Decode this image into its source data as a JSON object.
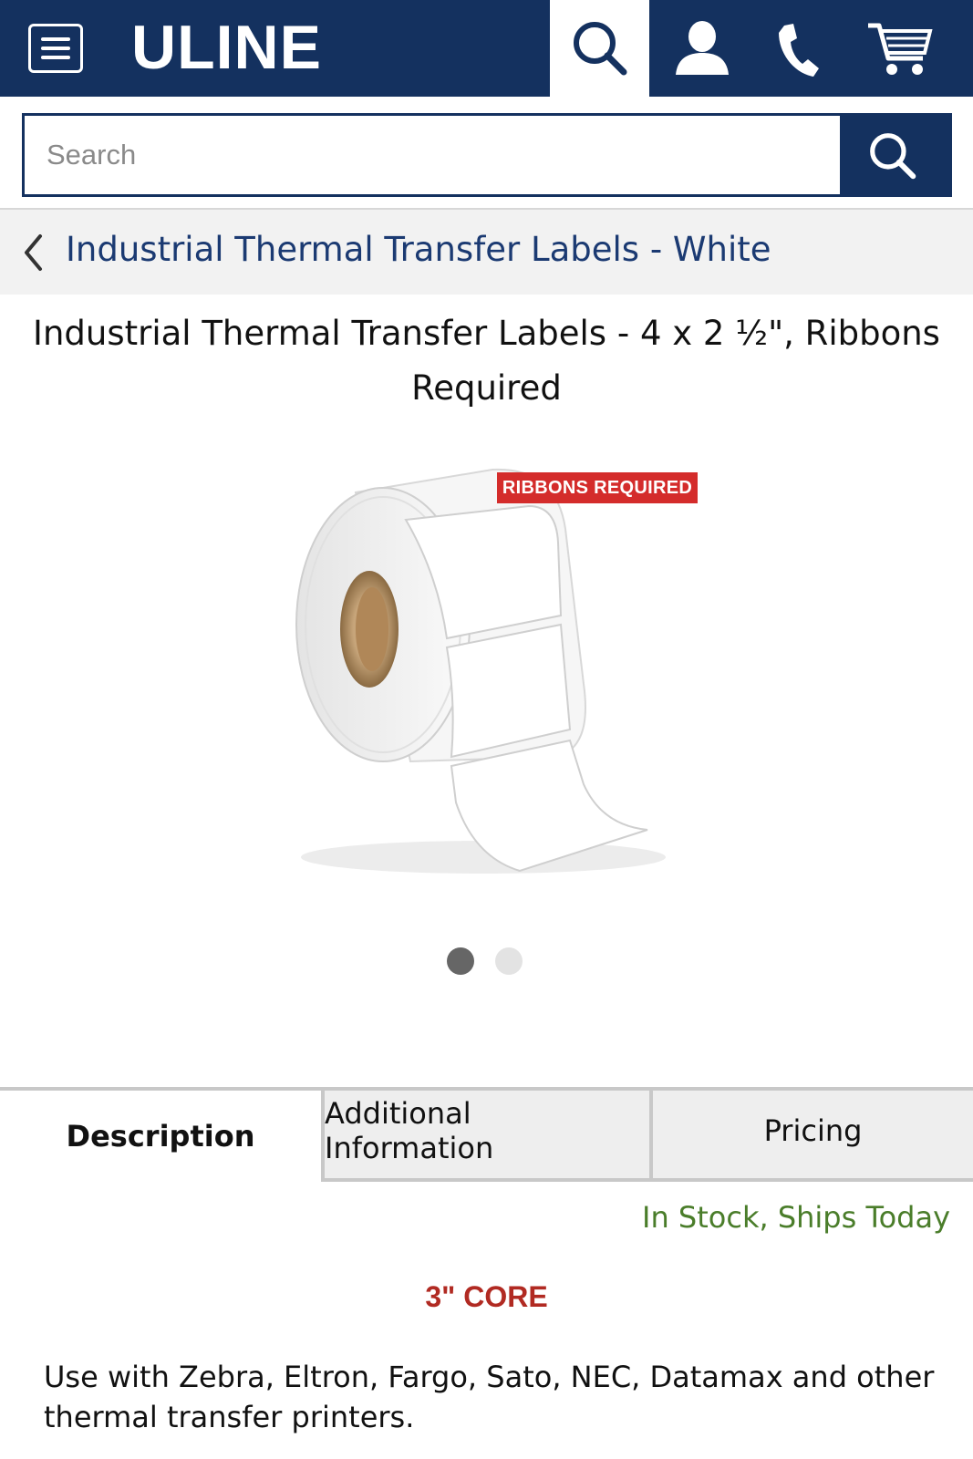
{
  "header": {
    "logo": "ULINE",
    "icons": [
      "menu-icon",
      "search-icon",
      "user-icon",
      "phone-icon",
      "cart-icon"
    ]
  },
  "search": {
    "placeholder": "Search"
  },
  "breadcrumb": {
    "label": "Industrial Thermal Transfer Labels - White"
  },
  "product": {
    "title": "Industrial Thermal Transfer Labels - 4 x 2 ½\", Ribbons Required",
    "image_badge": "RIBBONS REQUIRED",
    "carousel": {
      "count": 2,
      "active": 1
    }
  },
  "tabs": [
    {
      "label": "Description",
      "active": true
    },
    {
      "label": "Additional Information",
      "active": false
    },
    {
      "label": "Pricing",
      "active": false
    }
  ],
  "stock_status": "In Stock, Ships Today",
  "core_label": "3\" CORE",
  "description": "Use with Zebra, Eltron, Fargo, Sato, NEC, Datamax and other thermal transfer printers.",
  "colors": {
    "brand_navy": "#14315f",
    "stock_green": "#4a7d2a",
    "core_red": "#b12a22",
    "badge_red": "#d42c2b"
  }
}
